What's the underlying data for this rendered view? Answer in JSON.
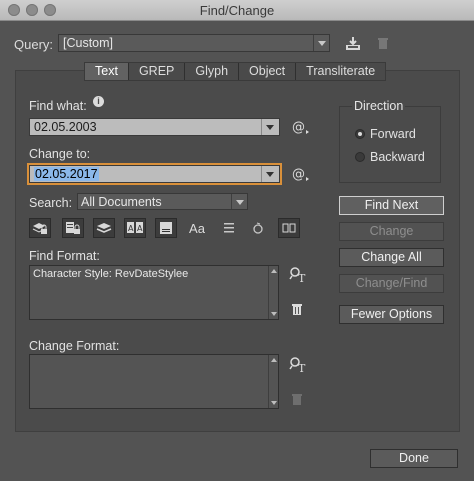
{
  "window": {
    "title": "Find/Change"
  },
  "query": {
    "label": "Query:",
    "value": "[Custom]"
  },
  "tabs": [
    {
      "label": "Text",
      "active": true
    },
    {
      "label": "GREP",
      "active": false
    },
    {
      "label": "Glyph",
      "active": false
    },
    {
      "label": "Object",
      "active": false
    },
    {
      "label": "Transliterate",
      "active": false
    }
  ],
  "find_what": {
    "label": "Find what:",
    "value": "02.05.2003"
  },
  "change_to": {
    "label": "Change to:",
    "value": "02.05.2017"
  },
  "search": {
    "label": "Search:",
    "value": "All Documents"
  },
  "find_format": {
    "label": "Find Format:",
    "value": "Character Style: RevDateStylee"
  },
  "change_format": {
    "label": "Change Format:",
    "value": ""
  },
  "direction": {
    "title": "Direction",
    "options": [
      {
        "label": "Forward",
        "selected": true
      },
      {
        "label": "Backward",
        "selected": false
      }
    ]
  },
  "buttons": {
    "find_next": "Find Next",
    "change": "Change",
    "change_all": "Change All",
    "change_find": "Change/Find",
    "fewer_options": "Fewer Options",
    "done": "Done"
  },
  "icons": {
    "text_tools_aa": "Aa"
  },
  "colors": {
    "focus": "#d9903a",
    "selection": "#8bb8ea",
    "background": "#535353"
  }
}
